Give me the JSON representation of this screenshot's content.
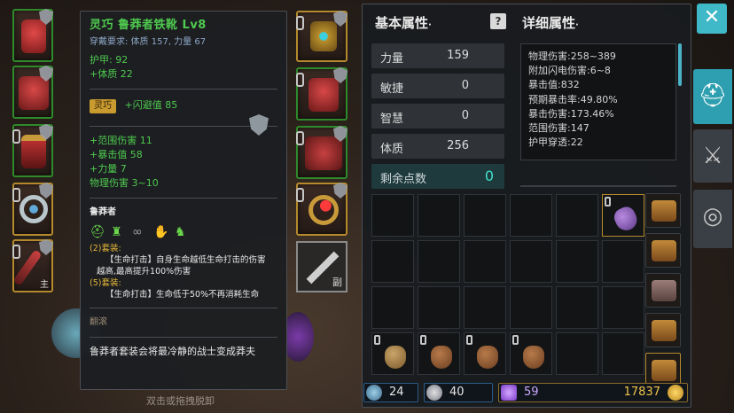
{
  "tooltip": {
    "title": "灵巧 鲁莽者铁靴 Lv8",
    "requirement": "穿戴要求:  体质 157, 力量 67",
    "armor": "护甲:  92",
    "constitution": "+体质 22",
    "affix_badge": "灵巧",
    "affix_value": "+闪避值 85",
    "bonus1": "+范围伤害 11",
    "bonus2": "+暴击值 58",
    "bonus3": "+力量 7",
    "bonus4": "物理伤害 3~10",
    "set_name": "鲁莽者",
    "set2_head": "(2)套装:",
    "set2_line1": "【生命打击】自身生命越低生命打击的伤害",
    "set2_line2": "越高,最高提升100%伤害",
    "set5_head": "(5)套装:",
    "set5_line1": "【生命打击】生命低于50%不再消耗生命",
    "rolling": "翻滚",
    "flavor": "鲁莽者套装会将最冷静的战士变成莽夫"
  },
  "hint": "双击或拖拽脱卸",
  "equip": {
    "weapon_tag": "主",
    "offhand_tag": "副"
  },
  "panel": {
    "basic_title": "基本属性",
    "detail_title": "详细属性",
    "help_glyph": "?",
    "attrs": [
      {
        "name": "力量",
        "value": "159"
      },
      {
        "name": "敏捷",
        "value": "0"
      },
      {
        "name": "智慧",
        "value": "0"
      },
      {
        "name": "体质",
        "value": "256"
      }
    ],
    "remain_label": "剩余点数",
    "remain_value": "0",
    "details": [
      "物理伤害:258~389",
      "附加闪电伤害:6~8",
      "暴击值:832",
      "预期暴击率:49.80%",
      "暴击伤害:173.46%",
      "范围伤害:147",
      "护甲穿透:22"
    ]
  },
  "bottom": {
    "stat1": "24",
    "stat2": "40",
    "gems": "59",
    "gold": "17837"
  },
  "icons": {
    "close": "close-icon",
    "helmet_tab": "helmet-icon",
    "sword_tab": "crossed-swords-icon",
    "settings_tab": "shield-target-icon"
  }
}
